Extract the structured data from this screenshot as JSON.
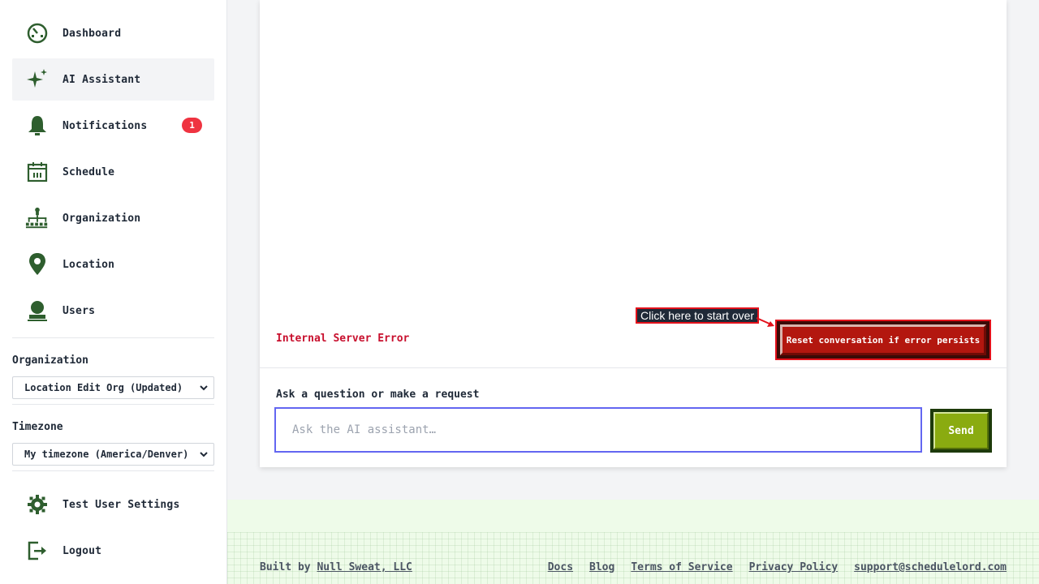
{
  "sidebar": {
    "items": [
      {
        "label": "Dashboard",
        "icon": "dashboard-icon"
      },
      {
        "label": "AI Assistant",
        "icon": "sparkle-icon",
        "active": true
      },
      {
        "label": "Notifications",
        "icon": "bell-icon",
        "badge": "1"
      },
      {
        "label": "Schedule",
        "icon": "calendar-icon"
      },
      {
        "label": "Organization",
        "icon": "org-chart-icon"
      },
      {
        "label": "Location",
        "icon": "map-pin-icon"
      },
      {
        "label": "Users",
        "icon": "user-icon"
      }
    ],
    "organization": {
      "label": "Organization",
      "selected": "Location Edit Org (Updated)"
    },
    "timezone": {
      "label": "Timezone",
      "selected": "My timezone (America/Denver)"
    },
    "bottom_items": [
      {
        "label": "Test User Settings",
        "icon": "gear-icon"
      },
      {
        "label": "Logout",
        "icon": "logout-icon"
      }
    ]
  },
  "chat": {
    "error": "Internal Server Error",
    "reset_label": "Reset conversation if error persists",
    "tooltip": "Click here to start over",
    "prompt_label": "Ask a question or make a request",
    "input_placeholder": "Ask the AI assistant…",
    "input_value": "",
    "send_label": "Send"
  },
  "footer": {
    "built_by_prefix": "Built by",
    "built_by_link": "Null Sweat, LLC",
    "links": [
      "Docs",
      "Blog",
      "Terms of Service",
      "Privacy Policy",
      "support@schedulelord.com"
    ]
  },
  "colors": {
    "icon_green": "#2e5e2e",
    "badge_red": "#ef3340",
    "error_red": "#c8102e",
    "send_green": "#8aab10",
    "input_border": "#6366f1"
  }
}
